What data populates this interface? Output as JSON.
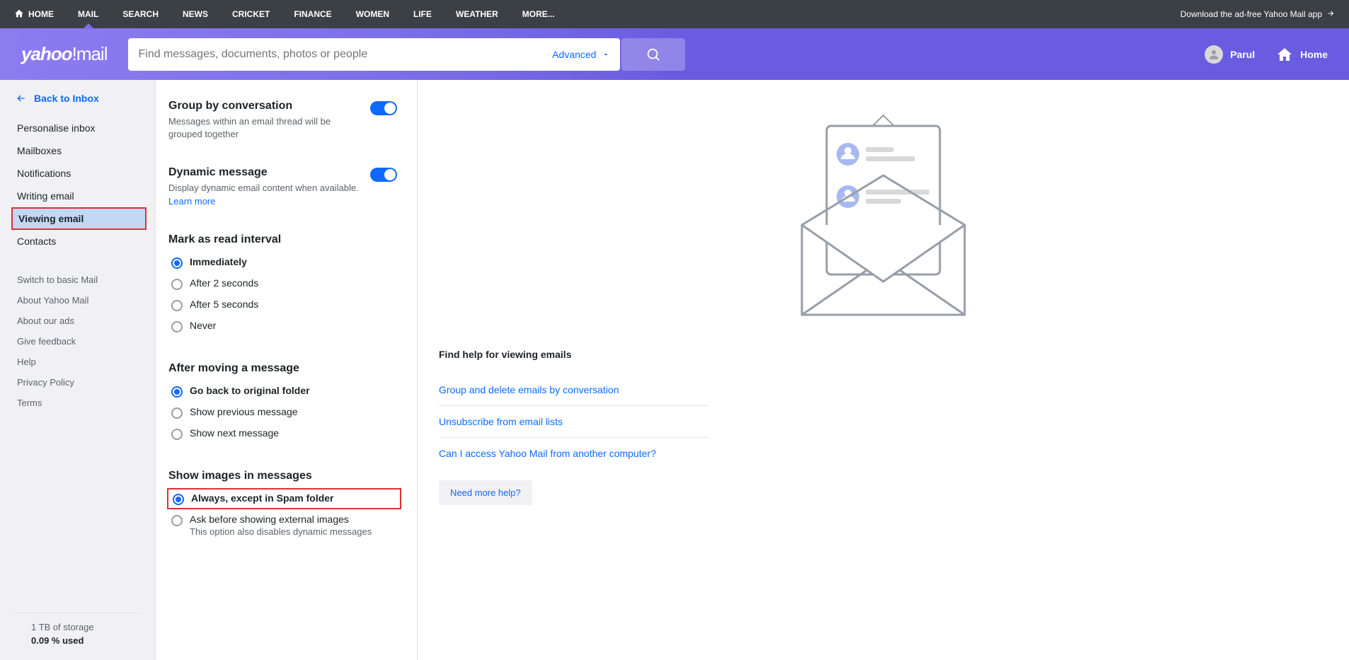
{
  "topnav": {
    "items": [
      "HOME",
      "MAIL",
      "SEARCH",
      "NEWS",
      "CRICKET",
      "FINANCE",
      "WOMEN",
      "LIFE",
      "WEATHER",
      "MORE..."
    ],
    "active_index": 1,
    "download": "Download the ad-free Yahoo Mail app"
  },
  "header": {
    "logo_a": "yahoo",
    "logo_b": "!",
    "logo_c": "mail",
    "search_placeholder": "Find messages, documents, photos or people",
    "advanced": "Advanced",
    "username": "Parul",
    "home": "Home"
  },
  "sidebar": {
    "back": "Back to Inbox",
    "items": [
      "Personalise inbox",
      "Mailboxes",
      "Notifications",
      "Writing email",
      "Viewing email",
      "Contacts"
    ],
    "selected_index": 4,
    "more": [
      "Switch to basic Mail",
      "About Yahoo Mail",
      "About our ads",
      "Give feedback",
      "Help",
      "Privacy Policy",
      "Terms"
    ],
    "storage": "1 TB of storage",
    "used": "0.09 % used"
  },
  "settings": {
    "group": {
      "title": "Group by conversation",
      "desc": "Messages within an email thread will be grouped together",
      "on": true
    },
    "dynamic": {
      "title": "Dynamic message",
      "desc": "Display dynamic email content when available.",
      "learn": "Learn more",
      "on": true
    },
    "read": {
      "title": "Mark as read interval",
      "options": [
        "Immediately",
        "After 2 seconds",
        "After 5 seconds",
        "Never"
      ],
      "selected": 0
    },
    "moving": {
      "title": "After moving a message",
      "options": [
        "Go back to original folder",
        "Show previous message",
        "Show next message"
      ],
      "selected": 0
    },
    "images": {
      "title": "Show images in messages",
      "options": [
        {
          "label": "Always, except in Spam folder",
          "sub": ""
        },
        {
          "label": "Ask before showing external images",
          "sub": "This option also disables dynamic messages"
        }
      ],
      "selected": 0
    }
  },
  "content": {
    "title": "Find help for viewing emails",
    "links": [
      "Group and delete emails by conversation",
      "Unsubscribe from email lists",
      "Can I access Yahoo Mail from another computer?"
    ],
    "more": "Need more help?"
  }
}
